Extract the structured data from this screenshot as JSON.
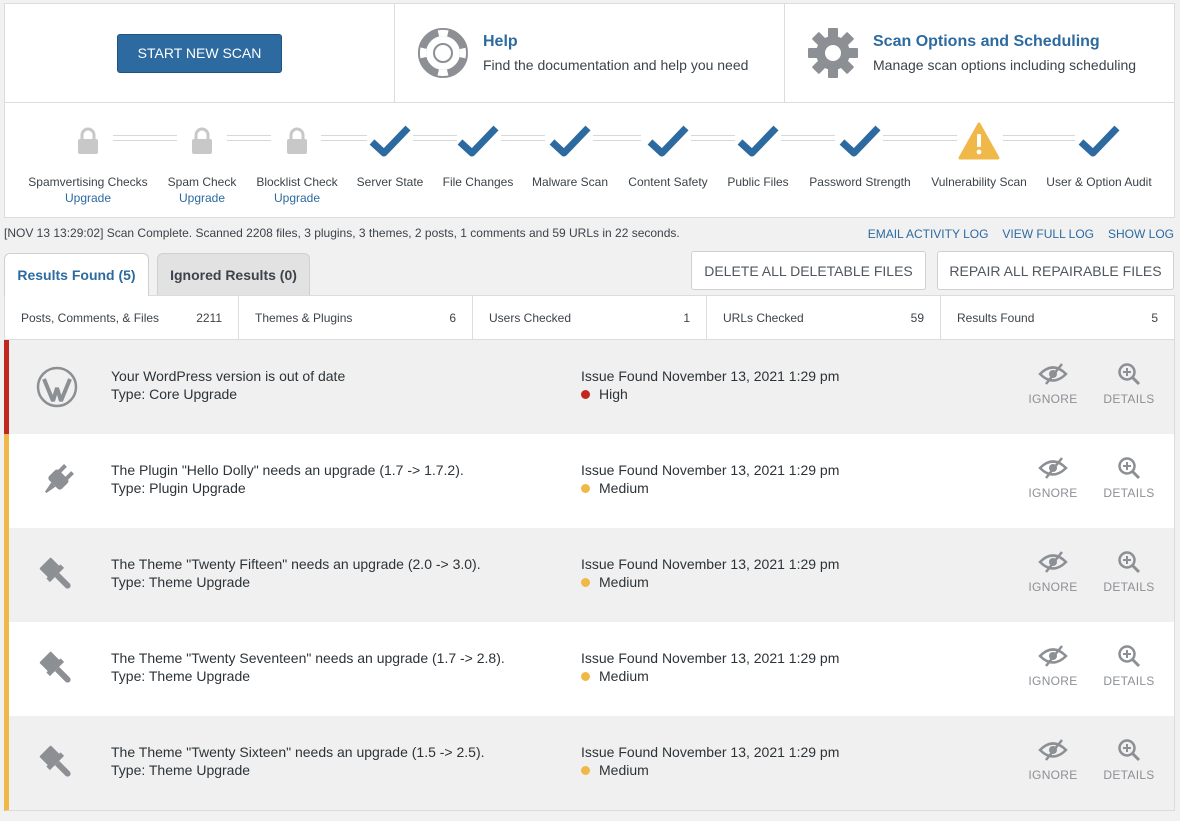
{
  "top": {
    "start_button": "START NEW SCAN",
    "help": {
      "title": "Help",
      "desc": "Find the documentation and help you need",
      "icon": "lifebuoy-icon"
    },
    "options": {
      "title": "Scan Options and Scheduling",
      "desc": "Manage scan options including scheduling",
      "icon": "gear-icon"
    }
  },
  "steps": [
    {
      "label": "Spamvertising Checks",
      "sub": "Upgrade",
      "status": "locked"
    },
    {
      "label": "Spam Check",
      "sub": "Upgrade",
      "status": "locked"
    },
    {
      "label": "Blocklist Check",
      "sub": "Upgrade",
      "status": "locked"
    },
    {
      "label": "Server State",
      "status": "complete"
    },
    {
      "label": "File Changes",
      "status": "complete"
    },
    {
      "label": "Malware Scan",
      "status": "complete"
    },
    {
      "label": "Content Safety",
      "status": "complete"
    },
    {
      "label": "Public Files",
      "status": "complete"
    },
    {
      "label": "Password Strength",
      "status": "complete"
    },
    {
      "label": "Vulnerability Scan",
      "status": "warning"
    },
    {
      "label": "User & Option Audit",
      "status": "complete"
    }
  ],
  "log": {
    "text": "[NOV 13 13:29:02] Scan Complete. Scanned 2208 files, 3 plugins, 3 themes, 2 posts, 1 comments and 59 URLs in 22 seconds.",
    "email": "EMAIL ACTIVITY LOG",
    "view": "VIEW FULL LOG",
    "show": "SHOW LOG"
  },
  "tabs": {
    "results": "Results Found (5)",
    "ignored": "Ignored Results (0)"
  },
  "actions": {
    "delete": "DELETE ALL DELETABLE FILES",
    "repair": "REPAIR ALL REPAIRABLE FILES"
  },
  "summary": [
    {
      "label": "Posts, Comments, & Files",
      "value": "2211"
    },
    {
      "label": "Themes & Plugins",
      "value": "6"
    },
    {
      "label": "Users Checked",
      "value": "1"
    },
    {
      "label": "URLs Checked",
      "value": "59"
    },
    {
      "label": "Results Found",
      "value": "5"
    }
  ],
  "issues": [
    {
      "title": "Your WordPress version is out of date",
      "type": "Type: Core Upgrade",
      "date": "Issue Found November 13, 2021 1:29 pm",
      "severity": "High",
      "severity_color": "#c0281f",
      "icon": "wordpress-icon",
      "ignore": "IGNORE",
      "details": "DETAILS"
    },
    {
      "title": "The Plugin \"Hello Dolly\" needs an upgrade (1.7 -> 1.7.2).",
      "type": "Type: Plugin Upgrade",
      "date": "Issue Found November 13, 2021 1:29 pm",
      "severity": "Medium",
      "severity_color": "#f0b849",
      "icon": "plugin-icon",
      "ignore": "IGNORE",
      "details": "DETAILS"
    },
    {
      "title": "The Theme \"Twenty Fifteen\" needs an upgrade (2.0 -> 3.0).",
      "type": "Type: Theme Upgrade",
      "date": "Issue Found November 13, 2021 1:29 pm",
      "severity": "Medium",
      "severity_color": "#f0b849",
      "icon": "brush-icon",
      "ignore": "IGNORE",
      "details": "DETAILS"
    },
    {
      "title": "The Theme \"Twenty Seventeen\" needs an upgrade (1.7 -> 2.8).",
      "type": "Type: Theme Upgrade",
      "date": "Issue Found November 13, 2021 1:29 pm",
      "severity": "Medium",
      "severity_color": "#f0b849",
      "icon": "brush-icon",
      "ignore": "IGNORE",
      "details": "DETAILS"
    },
    {
      "title": "The Theme \"Twenty Sixteen\" needs an upgrade (1.5 -> 2.5).",
      "type": "Type: Theme Upgrade",
      "date": "Issue Found November 13, 2021 1:29 pm",
      "severity": "Medium",
      "severity_color": "#f0b849",
      "icon": "brush-icon",
      "ignore": "IGNORE",
      "details": "DETAILS"
    }
  ],
  "colors": {
    "accent": "#2c6aa0",
    "warning": "#f0b849",
    "danger": "#c0281f",
    "locked": "#c8c8c8"
  }
}
